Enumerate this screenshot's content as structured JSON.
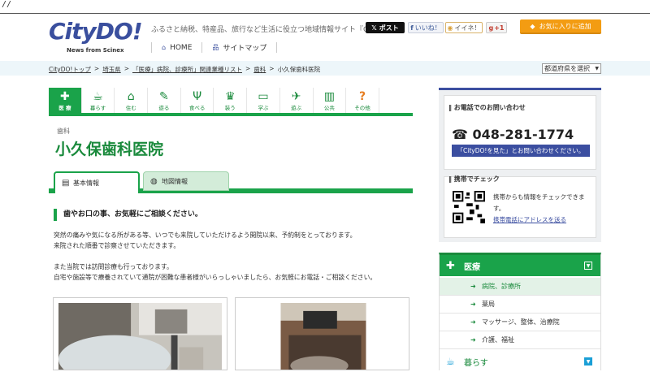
{
  "top": {
    "slashes": "//"
  },
  "logo": {
    "wordmark": "CityDO!",
    "tag": "News from Scinex"
  },
  "header": {
    "tagline": "ふるさと納税、特産品、旅行など生活に役立つ地域情報サイト『CityDO!』",
    "nav": [
      {
        "label": "HOME",
        "icon": "home-icon"
      },
      {
        "label": "サイトマップ",
        "icon": "sitemap-icon"
      }
    ]
  },
  "social": {
    "post": "ポスト",
    "like": "いいね！",
    "iine": "イイネ！",
    "gplus": "+1"
  },
  "favorite_label": "お気に入りに追加",
  "breadcrumb": [
    "CityDO!トップ",
    "埼玉県",
    "「医療」病院、診療所」関連業種リスト",
    "歯科",
    "小久保歯科医院"
  ],
  "breadcrumb_sep": ">",
  "pref_select": "都道府県を選択",
  "categories": [
    {
      "label": "医 療",
      "icon": "✚",
      "active": true
    },
    {
      "label": "暮らす",
      "icon": "☕"
    },
    {
      "label": "住む",
      "icon": "⌂"
    },
    {
      "label": "遊る",
      "icon": "✎"
    },
    {
      "label": "食べる",
      "icon": "Ψ"
    },
    {
      "label": "装う",
      "icon": "♛"
    },
    {
      "label": "学ぶ",
      "icon": "▭"
    },
    {
      "label": "遊ぶ",
      "icon": "✈"
    },
    {
      "label": "公共",
      "icon": "▥"
    },
    {
      "label": "その他",
      "icon": "?"
    }
  ],
  "business": {
    "kind": "歯科",
    "name": "小久保歯科医院"
  },
  "tabs": {
    "basic": "基本情報",
    "map": "地図情報"
  },
  "intro": {
    "heading": "歯やお口の事、お気軽にご相談ください。",
    "para1": [
      "突然の痛みや気になる所がある等、いつでも来院していただけるよう開院以来、予約制をとっております。",
      "来院された順番で診察させていただきます。"
    ],
    "para2": [
      "また当院では訪問診療も行っております。",
      "自宅や施設等で療養されていて通院が困難な患者様がいらっしゃいましたら、お気軽にお電話・ご相談ください。"
    ]
  },
  "side": {
    "phone_heading": "お電話でのお問い合わせ",
    "tel": "048-281-1774",
    "tel_note": "「CityDO!を見た」とお問い合わせください。",
    "mobile_heading": "携帯でチェック",
    "mobile_text": "携帯からも情報をチェックできます。",
    "mobile_link": "携帯電話にアドレスを送る"
  },
  "accordion": {
    "head": "医療",
    "items": [
      "病院、診療所",
      "薬局",
      "マッサージ、整体、治療院",
      "介護、福祉"
    ],
    "next": "暮らす"
  },
  "colors": {
    "brand_green": "#1aa34a",
    "brand_blue": "#3b4ea0",
    "accent_orange": "#f39c12"
  }
}
